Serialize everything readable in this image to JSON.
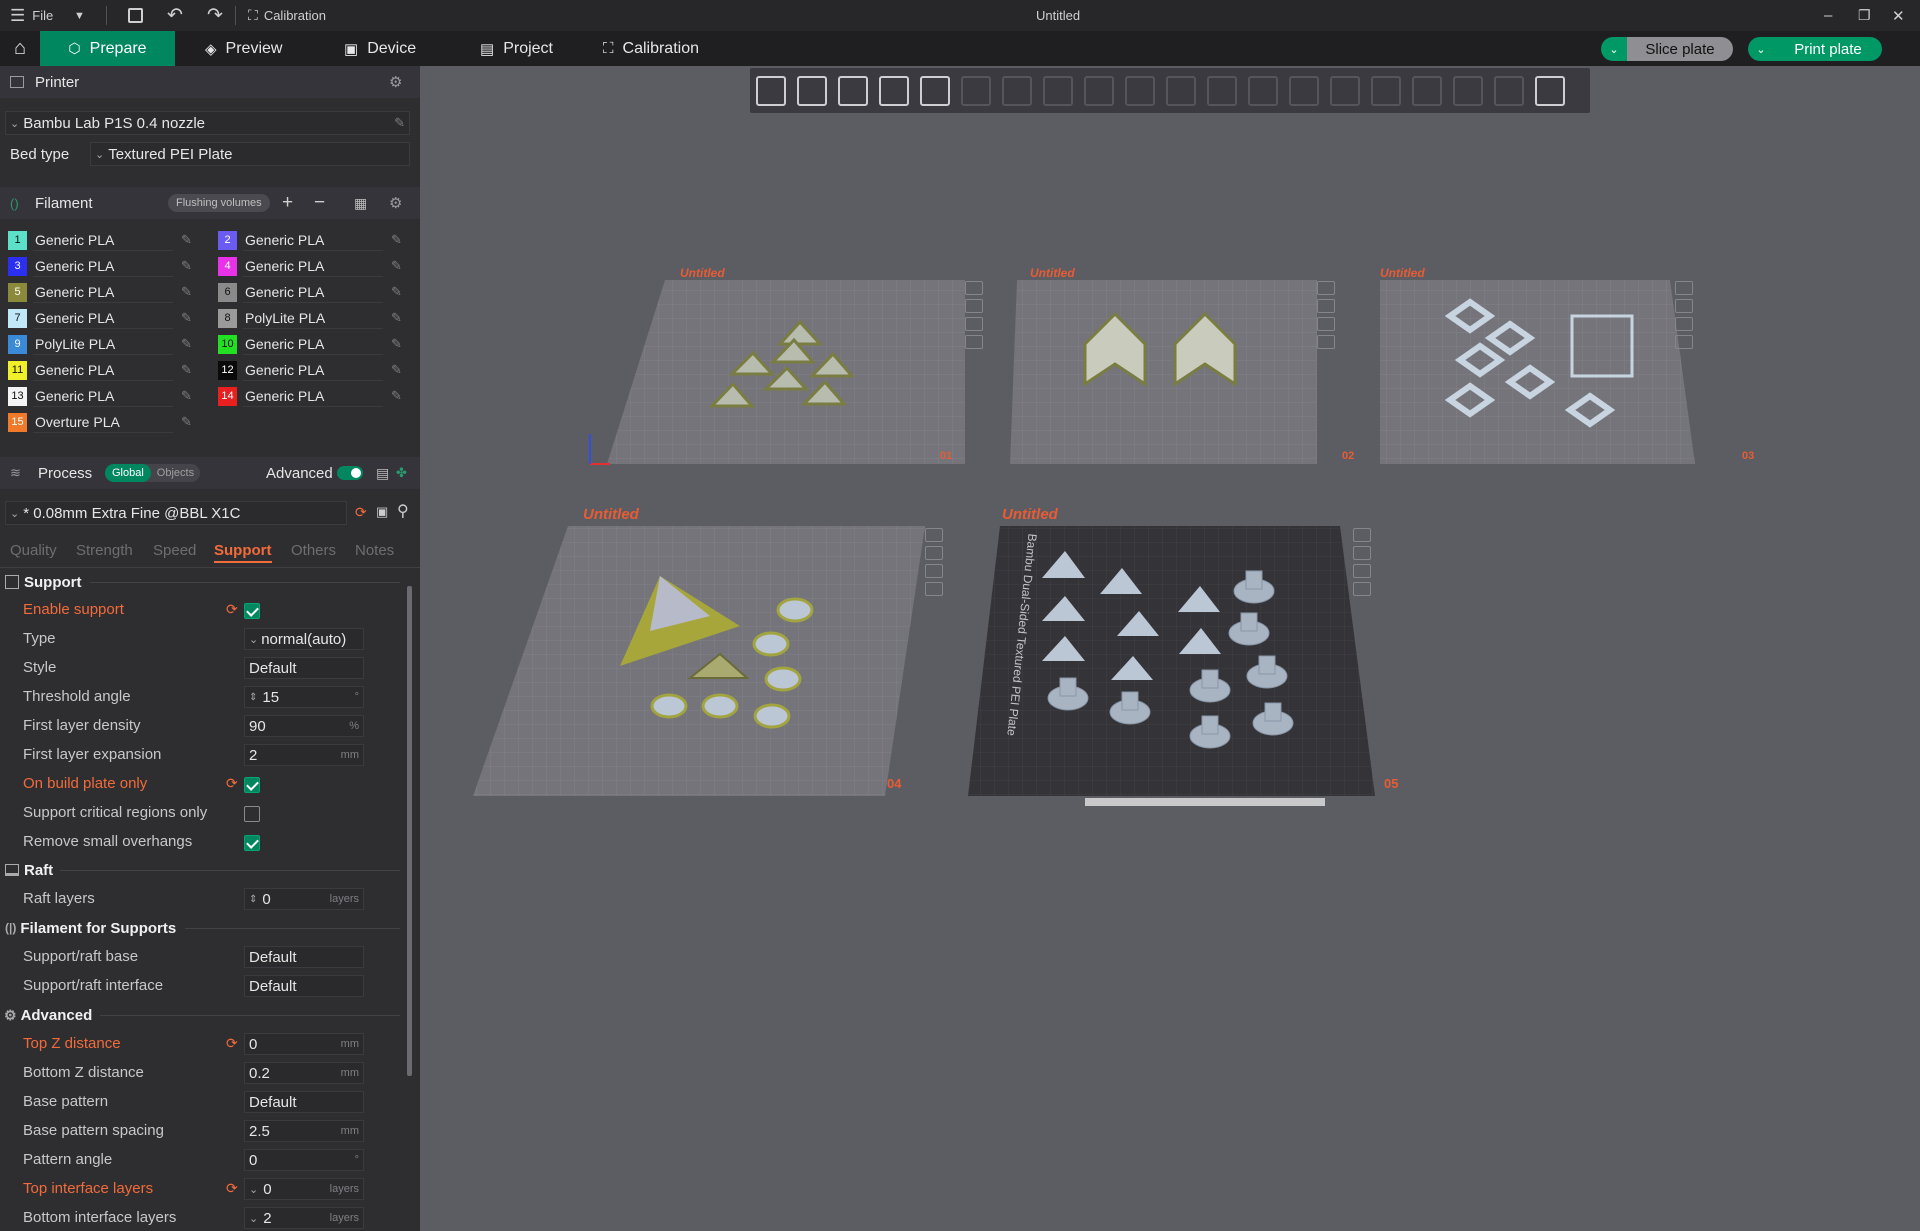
{
  "titlebar": {
    "file_label": "File",
    "calibration_label": "Calibration",
    "document_title": "Untitled"
  },
  "tabs": [
    {
      "label": "Prepare",
      "active": true
    },
    {
      "label": "Preview",
      "active": false
    },
    {
      "label": "Device",
      "active": false
    },
    {
      "label": "Project",
      "active": false
    },
    {
      "label": "Calibration",
      "active": false
    }
  ],
  "actions": {
    "slice_label": "Slice plate",
    "print_label": "Print plate"
  },
  "printer": {
    "section_title": "Printer",
    "name": "Bambu Lab P1S 0.4 nozzle",
    "bed_type_label": "Bed type",
    "bed_type_value": "Textured PEI Plate"
  },
  "filament": {
    "section_title": "Filament",
    "flushing_label": "Flushing volumes",
    "items": [
      {
        "num": "1",
        "name": "Generic PLA",
        "color": "#5de0c8"
      },
      {
        "num": "2",
        "name": "Generic PLA",
        "color": "#6a5cf0"
      },
      {
        "num": "3",
        "name": "Generic PLA",
        "color": "#2a2ff0"
      },
      {
        "num": "4",
        "name": "Generic PLA",
        "color": "#e832e8"
      },
      {
        "num": "5",
        "name": "Generic PLA",
        "color": "#8a8a3a"
      },
      {
        "num": "6",
        "name": "Generic PLA",
        "color": "#8a8a8a"
      },
      {
        "num": "7",
        "name": "Generic PLA",
        "color": "#c0e8f8"
      },
      {
        "num": "8",
        "name": "PolyLite PLA",
        "color": "#9a9a9a"
      },
      {
        "num": "9",
        "name": "PolyLite PLA",
        "color": "#3a8ad8"
      },
      {
        "num": "10",
        "name": "Generic PLA",
        "color": "#22e022"
      },
      {
        "num": "11",
        "name": "Generic PLA",
        "color": "#f0f02a"
      },
      {
        "num": "12",
        "name": "Generic PLA",
        "color": "#0a0a0a"
      },
      {
        "num": "13",
        "name": "Generic PLA",
        "color": "#f4f4f4"
      },
      {
        "num": "14",
        "name": "Generic PLA",
        "color": "#e82020"
      },
      {
        "num": "15",
        "name": "Overture PLA",
        "color": "#f07a2a"
      }
    ]
  },
  "process": {
    "section_title": "Process",
    "global_label": "Global",
    "objects_label": "Objects",
    "advanced_label": "Advanced",
    "preset": "* 0.08mm Extra Fine @BBL X1C",
    "subtabs": [
      "Quality",
      "Strength",
      "Speed",
      "Support",
      "Others",
      "Notes"
    ],
    "active_subtab": "Support"
  },
  "support": {
    "group_title": "Support",
    "enable_support": {
      "label": "Enable support",
      "checked": true
    },
    "type": {
      "label": "Type",
      "value": "normal(auto)"
    },
    "style": {
      "label": "Style",
      "value": "Default"
    },
    "threshold_angle": {
      "label": "Threshold angle",
      "value": "15",
      "unit": "°"
    },
    "first_layer_density": {
      "label": "First layer density",
      "value": "90",
      "unit": "%"
    },
    "first_layer_expansion": {
      "label": "First layer expansion",
      "value": "2",
      "unit": "mm"
    },
    "on_build_plate_only": {
      "label": "On build plate only",
      "checked": true
    },
    "critical_regions": {
      "label": "Support critical regions only",
      "checked": false
    },
    "remove_small_overhangs": {
      "label": "Remove small overhangs",
      "checked": true
    }
  },
  "raft": {
    "group_title": "Raft",
    "raft_layers": {
      "label": "Raft layers",
      "value": "0",
      "unit": "layers"
    }
  },
  "filament_for_supports": {
    "group_title": "Filament for Supports",
    "base": {
      "label": "Support/raft base",
      "value": "Default"
    },
    "interface": {
      "label": "Support/raft interface",
      "value": "Default"
    }
  },
  "advanced": {
    "group_title": "Advanced",
    "top_z_distance": {
      "label": "Top Z distance",
      "value": "0",
      "unit": "mm"
    },
    "bottom_z_distance": {
      "label": "Bottom Z distance",
      "value": "0.2",
      "unit": "mm"
    },
    "base_pattern": {
      "label": "Base pattern",
      "value": "Default"
    },
    "base_pattern_spacing": {
      "label": "Base pattern spacing",
      "value": "2.5",
      "unit": "mm"
    },
    "pattern_angle": {
      "label": "Pattern angle",
      "value": "0",
      "unit": "°"
    },
    "top_interface_layers": {
      "label": "Top interface layers",
      "value": "0",
      "unit": "layers"
    },
    "bottom_interface_layers": {
      "label": "Bottom interface layers",
      "value": "2",
      "unit": "layers"
    }
  },
  "plates": [
    {
      "name": "Untitled",
      "number": "01"
    },
    {
      "name": "Untitled",
      "number": "02"
    },
    {
      "name": "Untitled",
      "number": "03"
    },
    {
      "name": "Untitled",
      "number": "04"
    },
    {
      "name": "Untitled",
      "number": "05",
      "bed_label": "Bambu Dual-Sided Textured PEI Plate"
    }
  ],
  "colors": {
    "accent": "#00875f",
    "modified": "#f26b3a"
  }
}
